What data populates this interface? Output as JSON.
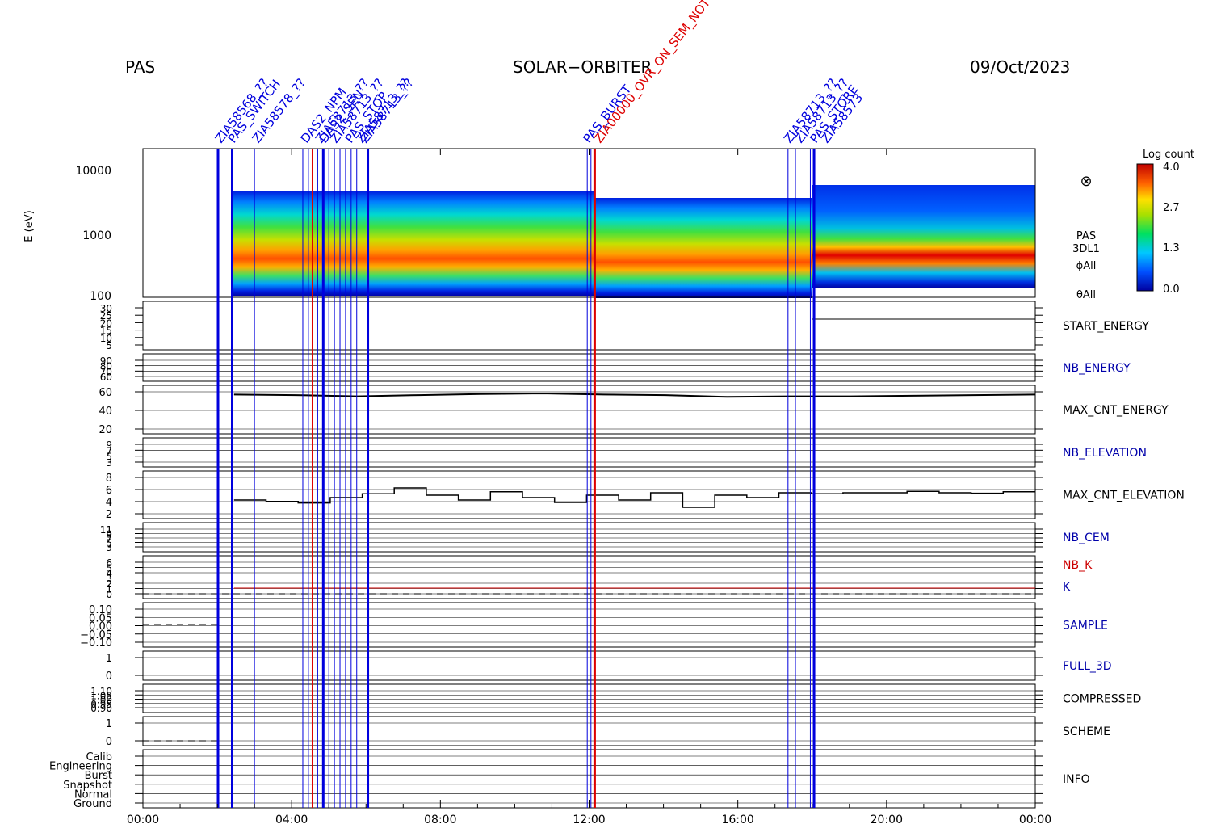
{
  "header": {
    "instrument": "PAS",
    "mission": "SOLAR−ORBITER",
    "date": "09/Oct/2023"
  },
  "colors": {
    "event_blue": "#0000dd",
    "event_red": "#dd0000",
    "axis": "#000000"
  },
  "colorbar": {
    "title": "Log count",
    "ticks": [
      "4.0",
      "2.7",
      "1.3",
      "0.0"
    ]
  },
  "spectrogram": {
    "ylabel": "E (eV)",
    "yticks": [
      "10000",
      "1000",
      "100"
    ],
    "right_labels": [
      "PAS",
      "3DL1",
      "ϕAll",
      "θAll"
    ],
    "symbol": "⊗"
  },
  "panels": [
    {
      "label": "START_ENERGY",
      "color": "#000000",
      "ticks": [
        "30",
        "25",
        "20",
        "15",
        "10",
        "5"
      ]
    },
    {
      "label": "NB_ENERGY",
      "color": "#0000aa",
      "ticks": [
        "90",
        "80",
        "70",
        "60"
      ]
    },
    {
      "label": "MAX_CNT_ENERGY",
      "color": "#000000",
      "ticks": [
        "60",
        "40",
        "20"
      ]
    },
    {
      "label": "NB_ELEVATION",
      "color": "#0000aa",
      "ticks": [
        "9",
        "7",
        "5",
        "3"
      ]
    },
    {
      "label": "MAX_CNT_ELEVATION",
      "color": "#000000",
      "ticks": [
        "8",
        "6",
        "4",
        "2"
      ]
    },
    {
      "label": "NB_CEM",
      "color": "#0000aa",
      "ticks": [
        "11",
        "9",
        "7",
        "5",
        "3"
      ]
    },
    {
      "label": "NB_K",
      "label2": "K",
      "color": "#cc0000",
      "color2": "#0000aa",
      "ticks": [
        "6",
        "5",
        "4",
        "3",
        "2",
        "1",
        "0"
      ]
    },
    {
      "label": "SAMPLE",
      "color": "#0000aa",
      "ticks": [
        "0.10",
        "0.05",
        "0.00",
        "−0.05",
        "−0.10"
      ]
    },
    {
      "label": "FULL_3D",
      "color": "#0000aa",
      "ticks": [
        "1",
        "0"
      ]
    },
    {
      "label": "COMPRESSED",
      "color": "#000000",
      "ticks": [
        "1.10",
        "1.05",
        "1.00",
        "0.95",
        "0.90"
      ]
    },
    {
      "label": "SCHEME",
      "color": "#000000",
      "ticks": [
        "1",
        "0"
      ]
    },
    {
      "label": "INFO",
      "color": "#000000",
      "ticks": [
        "Calib",
        "Engineering",
        "Burst",
        "Snapshot",
        "Normal",
        "Ground"
      ]
    }
  ],
  "time_axis": {
    "labels": [
      "00:00",
      "04:00",
      "08:00",
      "12:00",
      "16:00",
      "20:00",
      "00:00"
    ]
  },
  "event_labels": [
    {
      "text": "ZIA58568_??",
      "color": "#0000dd"
    },
    {
      "text": "PAS_SWITCH",
      "color": "#0000dd"
    },
    {
      "text": "ZIA58578_??",
      "color": "#0000dd"
    },
    {
      "text": "DAS2_NPM",
      "color": "#0000dd"
    },
    {
      "text": "ZIA58713_??",
      "color": "#0000dd"
    },
    {
      "text": "ZIA58713_??",
      "color": "#0000dd"
    },
    {
      "text": "PAS_STOP",
      "color": "#0000dd"
    },
    {
      "text": "ZIA58713_??",
      "color": "#0000dd"
    },
    {
      "text": "DAS2_SEN",
      "color": "#0000dd"
    },
    {
      "text": "ZIA58713_??",
      "color": "#0000dd"
    },
    {
      "text": "ZIA00000_OVR_ON_SEM_NOT",
      "color": "#dd0000"
    },
    {
      "text": "PAS_BURST",
      "color": "#0000dd"
    },
    {
      "text": "ZIA58713_??",
      "color": "#0000dd"
    },
    {
      "text": "ZIA58713_??",
      "color": "#0000dd"
    },
    {
      "text": "PAS_STORE",
      "color": "#0000dd"
    },
    {
      "text": "ZIA58573",
      "color": "#0000dd"
    }
  ],
  "chart_data": {
    "type": "heatmap",
    "title": "",
    "xlabel": "",
    "x_range_hours": [
      0,
      24
    ],
    "x_ticks": [
      "00:00",
      "04:00",
      "08:00",
      "12:00",
      "16:00",
      "20:00",
      "00:00"
    ],
    "spectrogram": {
      "ylabel": "E (eV)",
      "y_scale": "log",
      "ylim": [
        100,
        20000
      ],
      "colorbar_label": "Log count",
      "colorbar_range": [
        0.0,
        4.0
      ],
      "data_start_hour": 2.45,
      "upper_energy_edge": [
        {
          "from": 2.45,
          "to": 12.1,
          "eV": 4500
        },
        {
          "from": 12.1,
          "to": 18.0,
          "eV": 3700
        },
        {
          "from": 18.0,
          "to": 24.0,
          "eV": 5800
        }
      ],
      "peak_energy_track": [
        {
          "h": 2.5,
          "eV": 520
        },
        {
          "h": 6,
          "eV": 540
        },
        {
          "h": 10,
          "eV": 600
        },
        {
          "h": 13,
          "eV": 680
        },
        {
          "h": 16,
          "eV": 700
        },
        {
          "h": 20,
          "eV": 600
        },
        {
          "h": 24,
          "eV": 540
        }
      ]
    },
    "max_cnt_energy": {
      "ylim": [
        0,
        70
      ],
      "values": [
        61,
        60,
        58,
        60,
        62,
        63,
        61,
        60,
        57,
        58,
        58,
        59,
        60,
        61
      ]
    },
    "max_cnt_elevation": {
      "ylim": [
        0,
        9
      ],
      "values": [
        3.5,
        3.2,
        2.9,
        4.0,
        4.8,
        6.0,
        4.5,
        3.5,
        5.2,
        4.0,
        3.0,
        4.5,
        3.5,
        5.0,
        2.0,
        4.5,
        4.0,
        5.0,
        4.8,
        5.0,
        5.0,
        5.3,
        5.0,
        4.9,
        5.2
      ]
    },
    "nb_k_value": 1,
    "event_lines_hours": [
      {
        "h": 2.02,
        "color": "#0000dd",
        "bold": true
      },
      {
        "h": 2.4,
        "color": "#0000dd",
        "bold": true
      },
      {
        "h": 3.0,
        "color": "#0000dd"
      },
      {
        "h": 4.3,
        "color": "#0000dd"
      },
      {
        "h": 4.45,
        "color": "#0000dd"
      },
      {
        "h": 4.55,
        "color": "#dd0000"
      },
      {
        "h": 4.7,
        "color": "#0000dd"
      },
      {
        "h": 4.85,
        "color": "#0000dd",
        "bold": true
      },
      {
        "h": 5.0,
        "color": "#0000dd"
      },
      {
        "h": 5.15,
        "color": "#0000dd"
      },
      {
        "h": 5.3,
        "color": "#0000dd"
      },
      {
        "h": 5.45,
        "color": "#0000dd"
      },
      {
        "h": 5.6,
        "color": "#0000dd"
      },
      {
        "h": 5.75,
        "color": "#0000dd"
      },
      {
        "h": 6.05,
        "color": "#0000dd",
        "bold": true
      },
      {
        "h": 11.95,
        "color": "#0000dd"
      },
      {
        "h": 12.05,
        "color": "#0000dd"
      },
      {
        "h": 12.15,
        "color": "#dd0000",
        "bold": true
      },
      {
        "h": 17.35,
        "color": "#0000dd"
      },
      {
        "h": 17.55,
        "color": "#0000dd"
      },
      {
        "h": 17.95,
        "color": "#0000dd"
      },
      {
        "h": 18.05,
        "color": "#0000dd",
        "bold": true
      }
    ]
  }
}
